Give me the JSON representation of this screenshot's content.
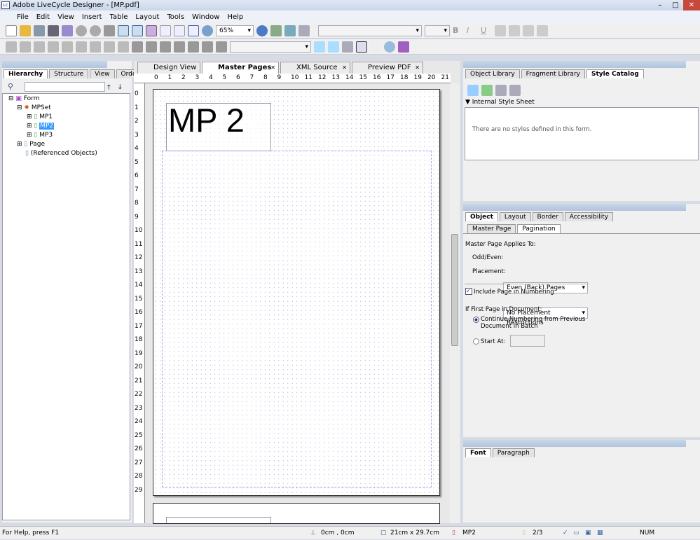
{
  "window": {
    "title": "Adobe LiveCycle Designer - [MP.pdf]",
    "logo": "Lc"
  },
  "menu": [
    "File",
    "Edit",
    "View",
    "Insert",
    "Table",
    "Layout",
    "Tools",
    "Window",
    "Help"
  ],
  "toolbar": {
    "zoom": "65%",
    "font_size": "",
    "font_name": ""
  },
  "left_panel": {
    "tabs": [
      "Hierarchy",
      "Structure",
      "View",
      "Order"
    ],
    "tree": [
      {
        "label": "Form",
        "level": 0
      },
      {
        "label": "MPSet",
        "level": 1
      },
      {
        "label": "MP1",
        "level": 2
      },
      {
        "label": "MP2",
        "level": 2,
        "selected": true
      },
      {
        "label": "MP3",
        "level": 2
      },
      {
        "label": "Page",
        "level": 1
      },
      {
        "label": "(Referenced Objects)",
        "level": 1
      }
    ]
  },
  "doc_tabs": [
    {
      "label": "Design View"
    },
    {
      "label": "Master Pages",
      "active": true
    },
    {
      "label": "XML Source"
    },
    {
      "label": "Preview PDF"
    }
  ],
  "ruler_h": [
    "0",
    "1",
    "2",
    "3",
    "4",
    "5",
    "6",
    "7",
    "8",
    "9",
    "10",
    "11",
    "12",
    "13",
    "14",
    "15",
    "16",
    "17",
    "18",
    "19",
    "20",
    "21"
  ],
  "ruler_v": [
    "0",
    "1",
    "2",
    "3",
    "4",
    "5",
    "6",
    "7",
    "8",
    "9",
    "10",
    "11",
    "12",
    "13",
    "14",
    "15",
    "16",
    "17",
    "18",
    "19",
    "20",
    "21",
    "22",
    "23",
    "24",
    "25",
    "26",
    "27",
    "28",
    "29"
  ],
  "canvas": {
    "title_text": "MP 2"
  },
  "library_panel": {
    "tabs": [
      "Object Library",
      "Fragment Library",
      "Style Catalog"
    ],
    "section": "Internal Style Sheet",
    "empty_msg": "There are no styles defined in this form."
  },
  "object_panel": {
    "tabs": [
      "Object",
      "Layout",
      "Border",
      "Accessibility"
    ],
    "subtabs": [
      "Master Page",
      "Pagination"
    ],
    "applies_to": "Master Page Applies To:",
    "odd_even_label": "Odd/Even:",
    "odd_even_value": "Even (Back) Pages",
    "placement_label": "Placement:",
    "placement_value": "No Placement Restrictions",
    "include_label": "Include Page in Numbering",
    "include_checked": true,
    "first_page_label": "If First Page in Document:",
    "continue_label": "Continue Numbering from Previous",
    "continue_label2": "Document in Batch",
    "start_at_label": "Start At:",
    "start_at_value": ""
  },
  "font_panel": {
    "tabs": [
      "Font",
      "Paragraph"
    ]
  },
  "status": {
    "help": "For Help, press F1",
    "coords": "0cm , 0cm",
    "size": "21cm x 29.7cm",
    "master": "MP2",
    "page": "2/3",
    "num": "NUM"
  }
}
